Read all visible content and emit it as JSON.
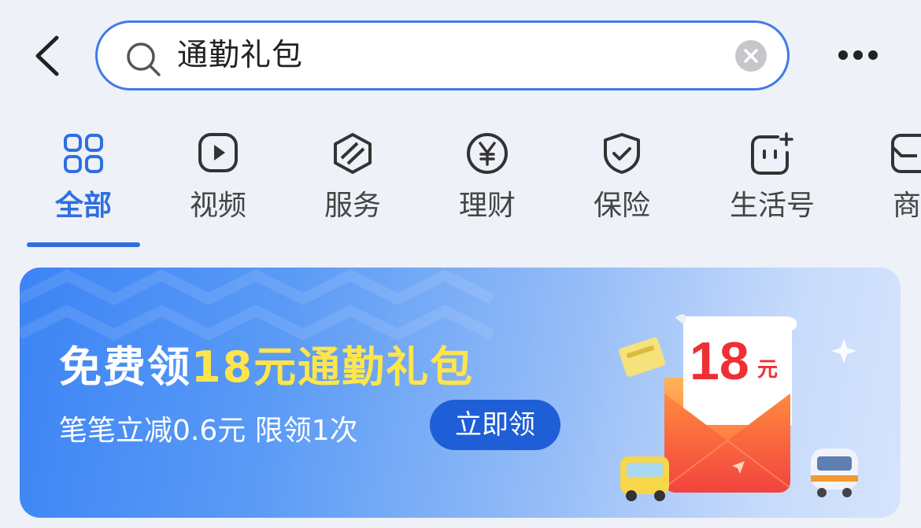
{
  "header": {
    "back_icon": "chevron-left-icon",
    "search_value": "通勤礼包",
    "search_icon": "search-icon",
    "clear_icon": "clear-icon",
    "more_icon": "more-icon"
  },
  "tabs": [
    {
      "label": "全部",
      "icon": "grid-icon",
      "active": true
    },
    {
      "label": "视频",
      "icon": "play-icon",
      "active": false
    },
    {
      "label": "服务",
      "icon": "service-icon",
      "active": false
    },
    {
      "label": "理财",
      "icon": "yen-icon",
      "active": false
    },
    {
      "label": "保险",
      "icon": "shield-check-icon",
      "active": false
    },
    {
      "label": "生活号",
      "icon": "life-account-icon",
      "active": false
    },
    {
      "label": "商",
      "icon": "shop-icon",
      "active": false
    }
  ],
  "banner": {
    "title_prefix": "免费领",
    "title_highlight": "18元通勤礼包",
    "subtitle": "笔笔立减0.6元 限领1次",
    "button": "立即领",
    "envelope_amount": "18",
    "envelope_unit": "元"
  },
  "colors": {
    "accent": "#2f6fe0",
    "highlight": "#ffe54a",
    "button_bg": "#1e5ed6"
  }
}
